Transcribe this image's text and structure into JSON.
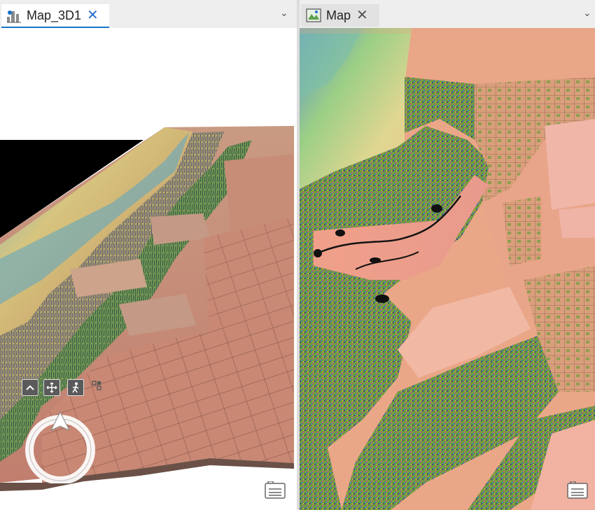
{
  "tabs": {
    "left": {
      "label": "Map_3D1",
      "close": "✕",
      "icon": "scene-3d-icon"
    },
    "right": {
      "label": "Map",
      "close": "✕",
      "icon": "map-icon"
    }
  },
  "dropdown_glyph": "⌄",
  "navigator": {
    "buttons": [
      "chevron-up-icon",
      "pan-move-icon",
      "walk-person-icon",
      "full-navigator-icon"
    ]
  },
  "colors": {
    "accent": "#1a73c9",
    "terrain_low": "#c98a74",
    "terrain_mid": "#d9c480",
    "terrain_high": "#5bb6c9",
    "vegetation": "#3f8f3a",
    "map_bg": "#e7a07f"
  }
}
